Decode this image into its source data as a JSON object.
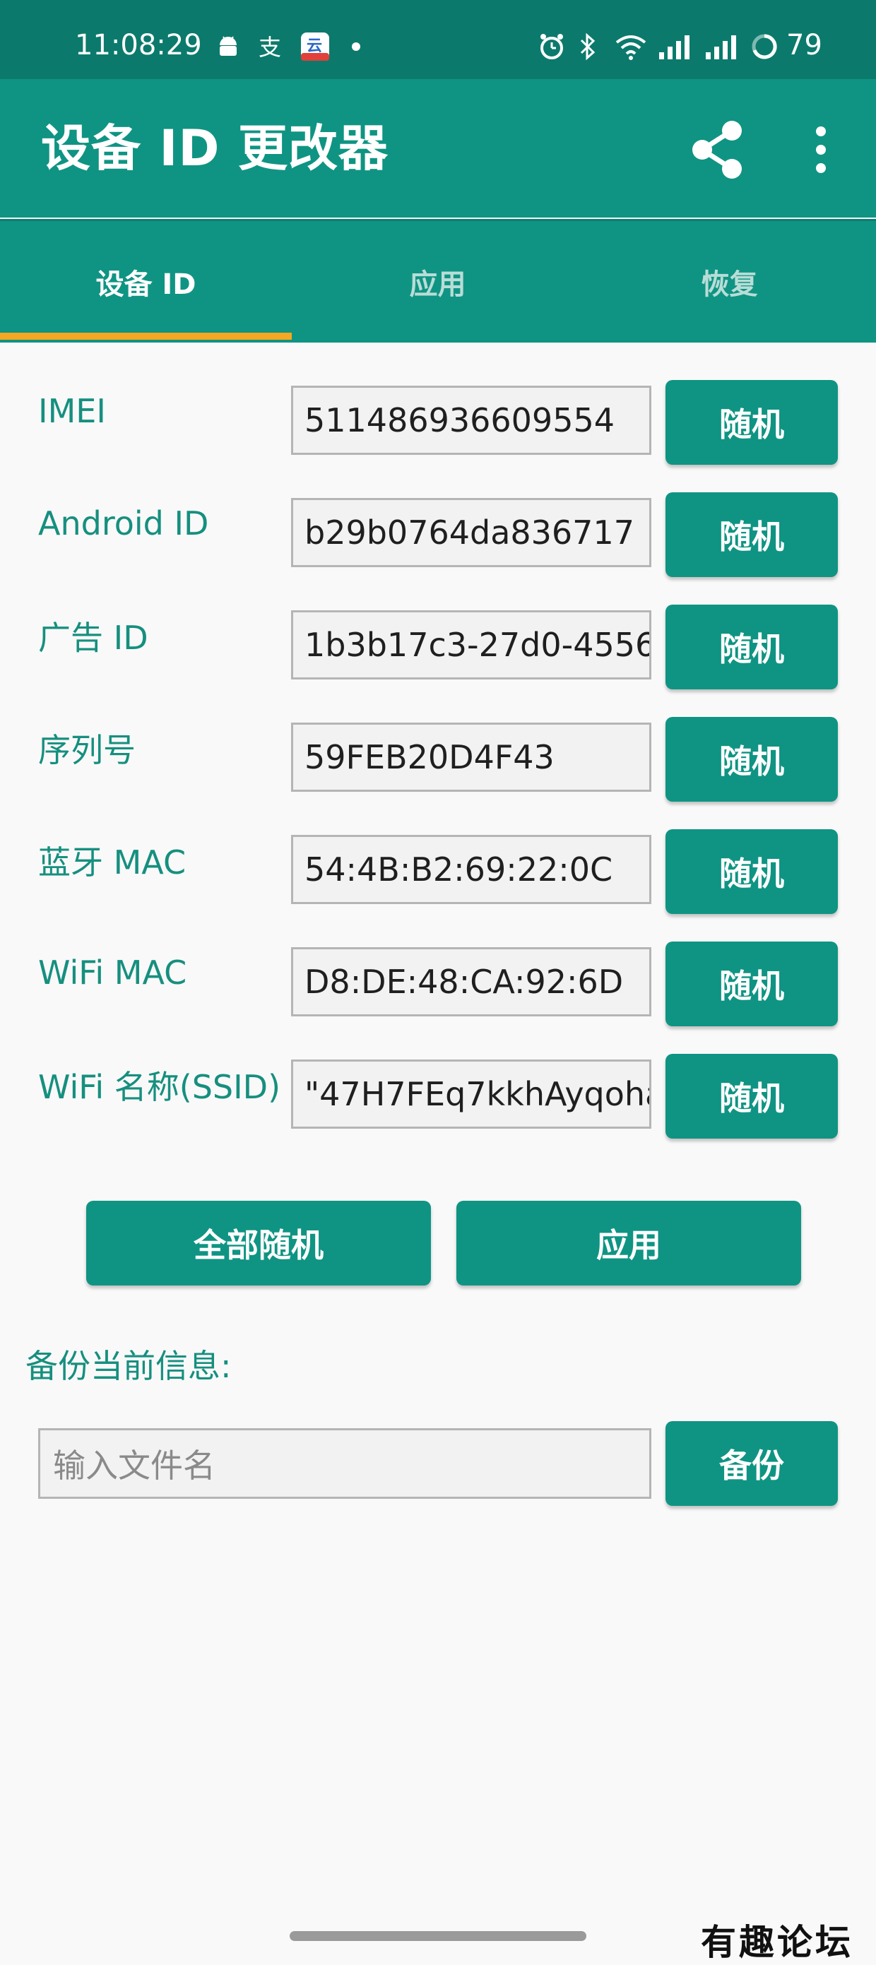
{
  "status_bar": {
    "time": "11:08:29",
    "battery": "79",
    "icons": [
      "android-icon",
      "alipay-icon",
      "cloud-app-icon",
      "dot-icon",
      "alarm-icon",
      "bluetooth-icon",
      "wifi-icon",
      "signal-icon",
      "signal-icon",
      "battery-ring-icon"
    ]
  },
  "app_bar": {
    "title": "设备 ID 更改器",
    "actions": [
      "share-icon",
      "more-vert-icon"
    ]
  },
  "tabs": [
    {
      "label": "设备 ID",
      "active": true
    },
    {
      "label": "应用",
      "active": false
    },
    {
      "label": "恢复",
      "active": false
    }
  ],
  "fields": [
    {
      "label": "IMEI",
      "value": "511486936609554",
      "button": "随机"
    },
    {
      "label": "Android ID",
      "value": "b29b0764da836717",
      "button": "随机"
    },
    {
      "label": "广告 ID",
      "value": "1b3b17c3-27d0-4556",
      "button": "随机"
    },
    {
      "label": "序列号",
      "value": "59FEB20D4F43",
      "button": "随机"
    },
    {
      "label": "蓝牙 MAC",
      "value": "54:4B:B2:69:22:0C",
      "button": "随机"
    },
    {
      "label": "WiFi MAC",
      "value": "D8:DE:48:CA:92:6D",
      "button": "随机"
    },
    {
      "label": "WiFi 名称(SSID)",
      "value": "\"47H7FEq7kkhAyqoha",
      "button": "随机"
    }
  ],
  "actions": {
    "randomize_all": "全部随机",
    "apply": "应用"
  },
  "backup": {
    "section_label": "备份当前信息:",
    "filename_placeholder": "输入文件名",
    "button": "备份"
  },
  "watermark": "有趣论坛",
  "colors": {
    "status_bar": "#0b7a6c",
    "primary": "#0f9483",
    "label_text": "#168f7f",
    "tab_indicator": "#f7a721",
    "background": "#f9f9f9"
  }
}
